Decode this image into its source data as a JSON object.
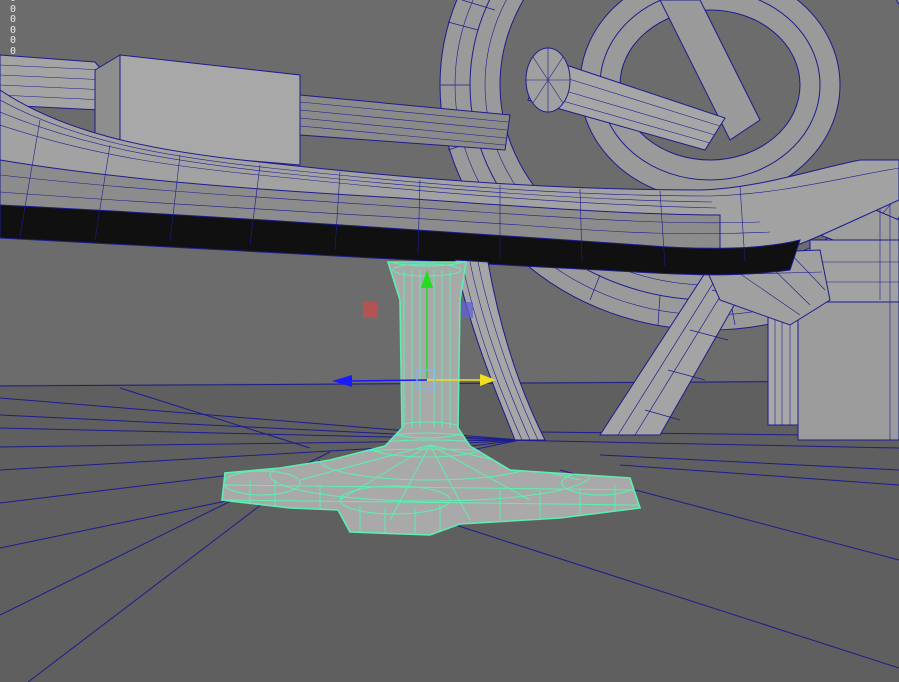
{
  "viewport": {
    "hud_values": [
      "0",
      "0",
      "0",
      "0",
      "0",
      "0"
    ],
    "colors": {
      "background": "#6a6a6a",
      "floor": "#5d5d5d",
      "wireframe": "#1c1c8e",
      "selection": "#5cf0b0",
      "mesh_fill": "#a6a6a6",
      "axis_y": "#22dd22",
      "axis_x": "#f0e020",
      "axis_z": "#1a1aff",
      "handle_red": "#c05050",
      "handle_blue": "#6060d0"
    },
    "selected_object": "pedestal-mesh",
    "manipulator": "move-tool"
  }
}
